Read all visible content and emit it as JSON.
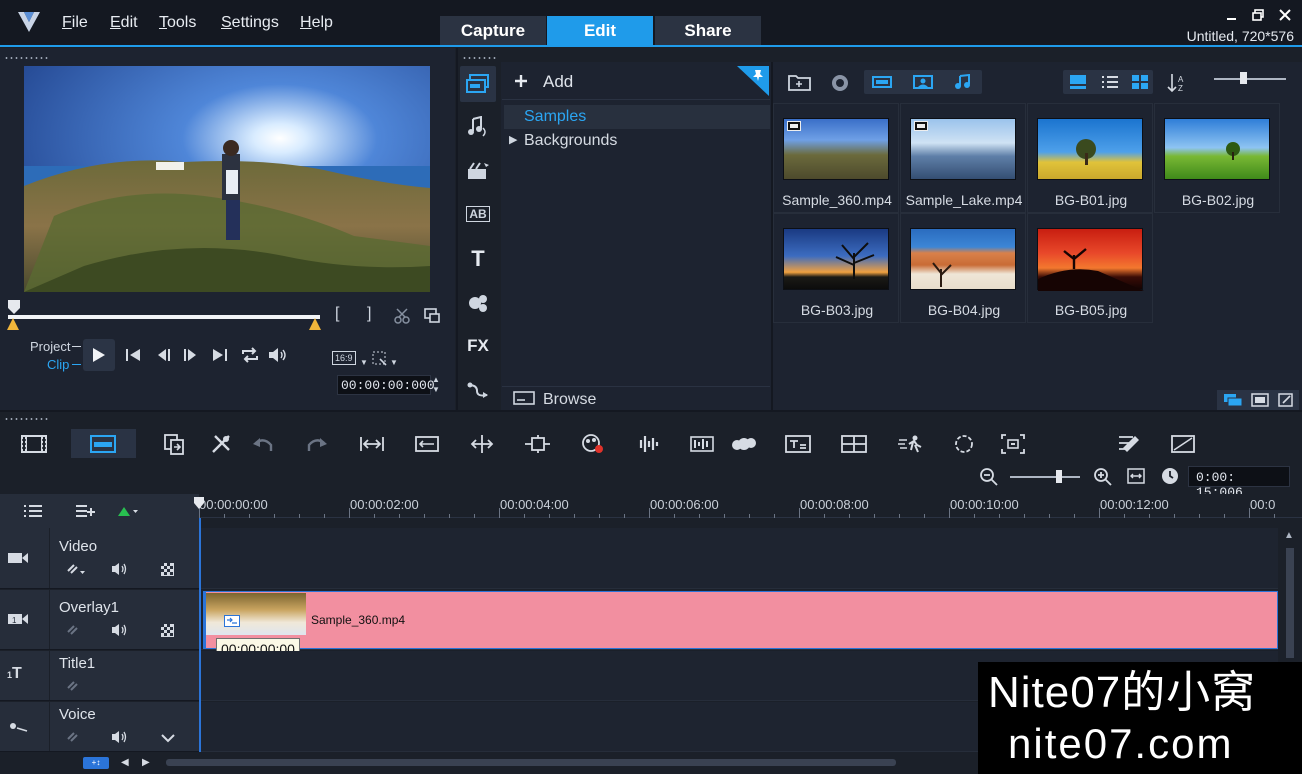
{
  "app": {
    "menu": [
      "File",
      "Edit",
      "Tools",
      "Settings",
      "Help"
    ],
    "menu_underline": [
      "F",
      "E",
      "T",
      "S",
      "H"
    ],
    "menu_rest": [
      "ile",
      "dit",
      "ools",
      "ettings",
      "elp"
    ],
    "tabs": [
      "Capture",
      "Edit",
      "Share"
    ],
    "active_tab": "Edit",
    "project_info": "Untitled, 720*576"
  },
  "player": {
    "project_label": "Project",
    "clip_label": "Clip",
    "aspect_label": "16:9",
    "timecode": "00:00:00:000"
  },
  "library": {
    "add_label": "Add",
    "folders": [
      "Samples",
      "Backgrounds"
    ],
    "selected_folder": "Samples",
    "browse_label": "Browse",
    "items": [
      {
        "name": "Sample_360.mp4",
        "kind": "video"
      },
      {
        "name": "Sample_Lake.mp4",
        "kind": "video"
      },
      {
        "name": "BG-B01.jpg",
        "kind": "image"
      },
      {
        "name": "BG-B02.jpg",
        "kind": "image"
      },
      {
        "name": "BG-B03.jpg",
        "kind": "image"
      },
      {
        "name": "BG-B04.jpg",
        "kind": "image"
      },
      {
        "name": "BG-B05.jpg",
        "kind": "image"
      }
    ]
  },
  "sidebar": {
    "icons": [
      "media-icon",
      "audio-icon",
      "instant-project-icon",
      "transition-icon",
      "title-icon",
      "graphics-icon",
      "filter-icon",
      "path-icon"
    ],
    "title_glyph": "T",
    "fx_label": "FX",
    "ab_label": "AB"
  },
  "timeline": {
    "duration": "0:00: 15:006",
    "ruler": [
      "00:00:00:00",
      "00:00:02:00",
      "00:00:04:00",
      "00:00:06:00",
      "00:00:08:00",
      "00:00:10:00",
      "00:00:12:00",
      "00:0"
    ],
    "tracks": [
      {
        "name": "Video"
      },
      {
        "name": "Overlay1"
      },
      {
        "name": "Title1"
      },
      {
        "name": "Voice"
      }
    ],
    "clip": {
      "name": "Sample_360.mp4",
      "tooltip": "00:00:00:00"
    }
  },
  "watermark": {
    "line1": "Nite07的小窝",
    "line2": "nite07.com"
  },
  "colors": {
    "accent": "#1f9bea",
    "clip_fill": "#f28fa0",
    "background": "#1b2029"
  }
}
